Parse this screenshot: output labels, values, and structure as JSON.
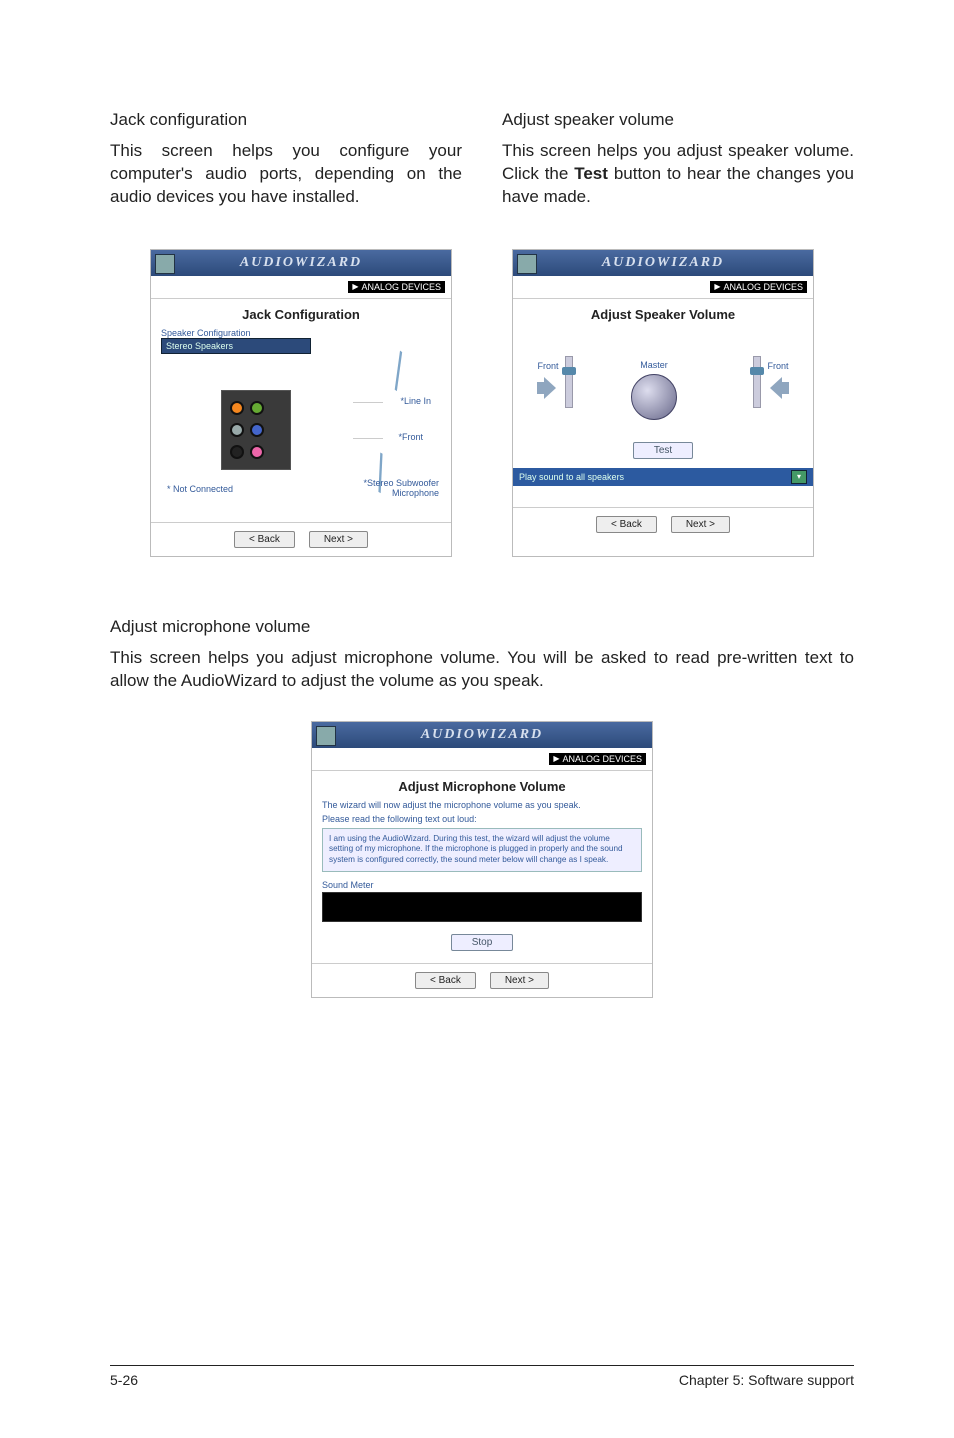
{
  "section1": {
    "left": {
      "heading": "Jack configuration",
      "body": "This screen helps you configure your computer's audio ports, depending on the audio devices you have installed."
    },
    "right": {
      "heading": "Adjust speaker volume",
      "body_pre": "This screen helps you adjust speaker volume. Click the ",
      "body_bold": "Test",
      "body_post": " button to hear the changes you have made."
    }
  },
  "wizard_common": {
    "title": "AUDIOWIZARD",
    "brand": "ANALOG DEVICES",
    "back": "< Back",
    "next": "Next >"
  },
  "jack_wizard": {
    "section_title": "Jack Configuration",
    "subtitle": "Speaker Configuration",
    "select": "Stereo Speakers",
    "label_linein": "*Line In",
    "label_front": "*Front",
    "label_subwoofer": "*Stereo Subwoofer\nMicrophone",
    "not_connected": "* Not Connected"
  },
  "spk_wizard": {
    "section_title": "Adjust Speaker Volume",
    "front": "Front",
    "master": "Master",
    "test": "Test",
    "strip": "Play sound to all speakers"
  },
  "section2": {
    "heading": "Adjust microphone volume",
    "body": "This screen helps you adjust microphone volume. You will be asked to read pre-written text to allow the AudioWizard to adjust the volume as you speak."
  },
  "mic_wizard": {
    "section_title": "Adjust Microphone Volume",
    "line1": "The wizard will now adjust the microphone volume as you speak.",
    "line2": "Please read the following text out loud:",
    "box": "I am using the AudioWizard. During this test, the wizard will adjust the volume setting of my microphone. If the microphone is plugged in properly and the sound system is configured correctly, the sound meter below will change as I speak.",
    "meter_label": "Sound Meter",
    "stop": "Stop"
  },
  "footer": {
    "left": "5-26",
    "right": "Chapter 5: Software support"
  }
}
